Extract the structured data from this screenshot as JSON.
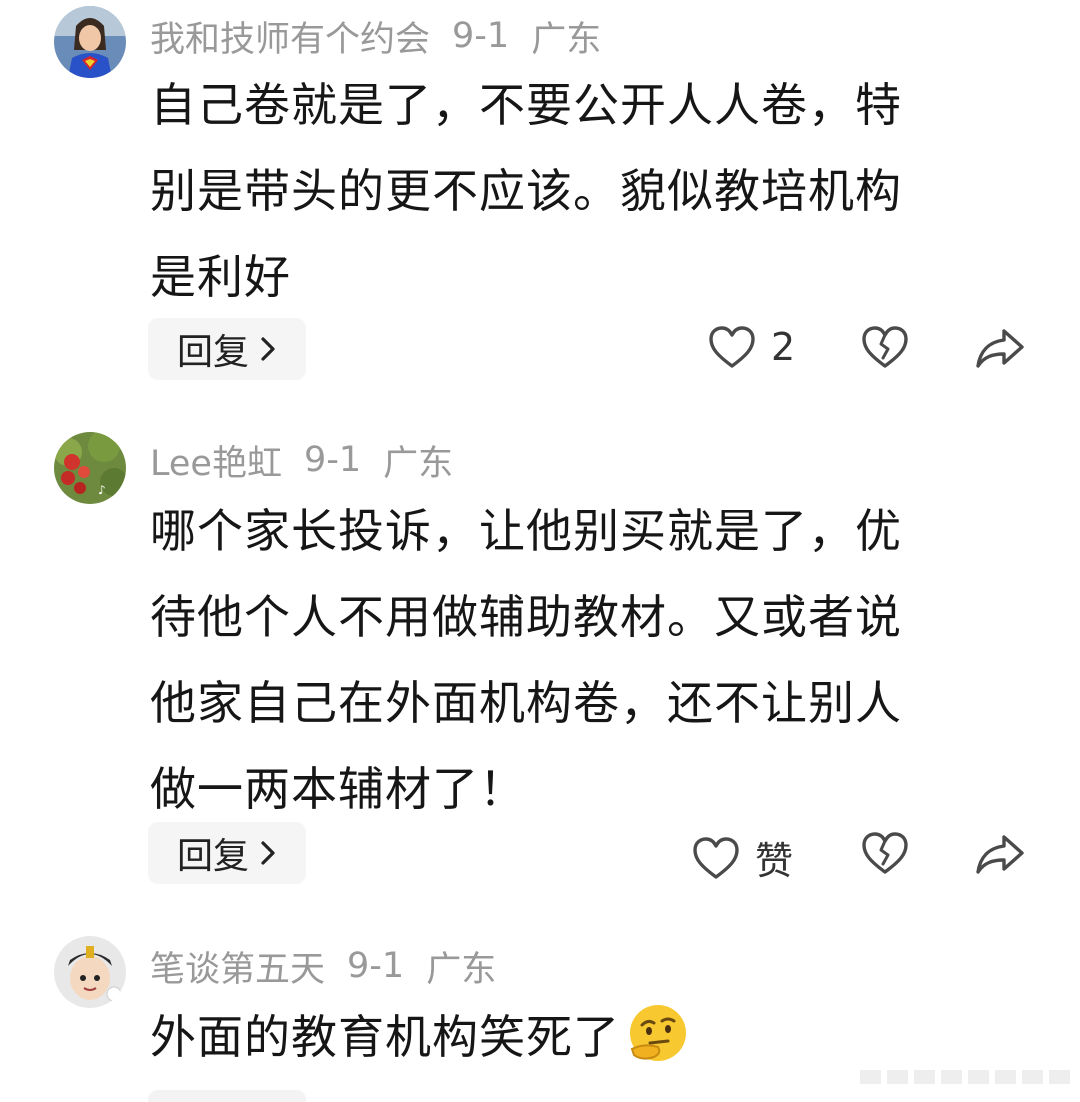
{
  "comments": [
    {
      "username": "我和技师有个约会",
      "date": "9-1",
      "location": "广东",
      "text_lines": [
        "自己卷就是了，不要公开人人卷，特",
        "别是带头的更不应该。貌似教培机构",
        "是利好"
      ],
      "reply_label": "回复",
      "like_label": "2",
      "avatar_icon": "superhero-avatar"
    },
    {
      "username": "Lee艳虹",
      "date": "9-1",
      "location": "广东",
      "text_lines": [
        "哪个家长投诉，让他别买就是了，优",
        "待他个人不用做辅助教材。又或者说",
        "他家自己在外面机构卷，还不让别人",
        "做一两本辅材了！"
      ],
      "reply_label": "回复",
      "like_label": "赞",
      "avatar_icon": "apple-tree-avatar"
    },
    {
      "username": "笔谈第五天",
      "date": "9-1",
      "location": "广东",
      "text_lines": [
        "外面的教育机构笑死了"
      ],
      "emoji_icon": "thinking-face-emoji",
      "avatar_icon": "cartoon-character-avatar"
    }
  ],
  "icons": {
    "like": "heart-outline-icon",
    "dislike": "broken-heart-icon",
    "share": "share-arrow-icon",
    "reply_chevron": "chevron-right-icon"
  },
  "colors": {
    "meta_gray": "#999999",
    "text": "#161616",
    "reply_bg": "#f5f5f5",
    "icon_gray": "#5a5a5a"
  }
}
